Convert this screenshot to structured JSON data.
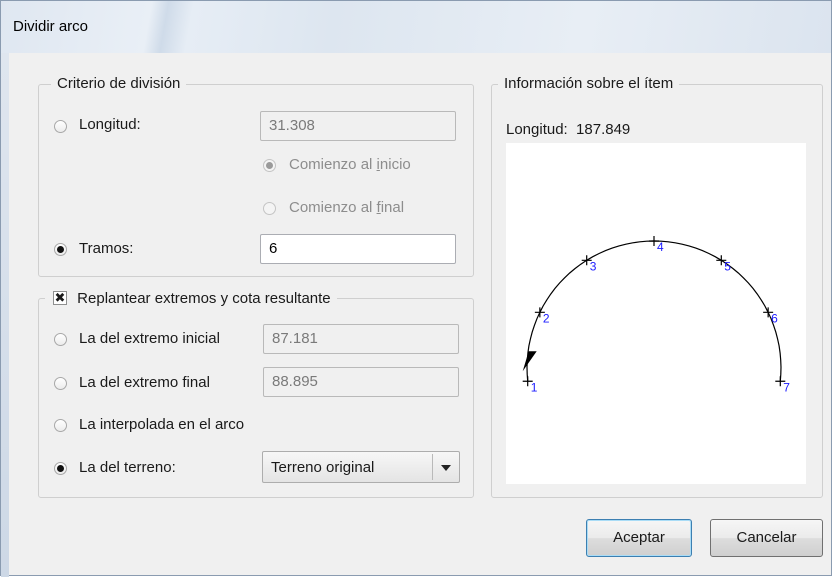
{
  "window": {
    "title": "Dividir arco"
  },
  "criterio": {
    "legend": "Criterio de división",
    "longitud_label": "Longitud:",
    "longitud_value": "31.308",
    "comienzo_inicio": "Comienzo al inicio",
    "comienzo_final": "Comienzo al final",
    "tramos_label": "Tramos:",
    "tramos_value": "6"
  },
  "replantear": {
    "legend": "Replantear extremos y cota resultante",
    "checked": true,
    "extremo_inicial_label": "La del extremo inicial",
    "extremo_inicial_value": "87.181",
    "extremo_final_label": "La del extremo final",
    "extremo_final_value": "88.895",
    "interpolada_label": "La interpolada en el arco",
    "terreno_label": "La del terreno:",
    "terreno_value": "Terreno original"
  },
  "info": {
    "legend": "Información sobre el ítem",
    "longitud_text": "Longitud:  187.849",
    "point_labels": [
      "1",
      "2",
      "3",
      "4",
      "5",
      "6",
      "7"
    ],
    "label_color": "#1a1aff"
  },
  "buttons": {
    "aceptar": "Aceptar",
    "cancelar": "Cancelar"
  }
}
